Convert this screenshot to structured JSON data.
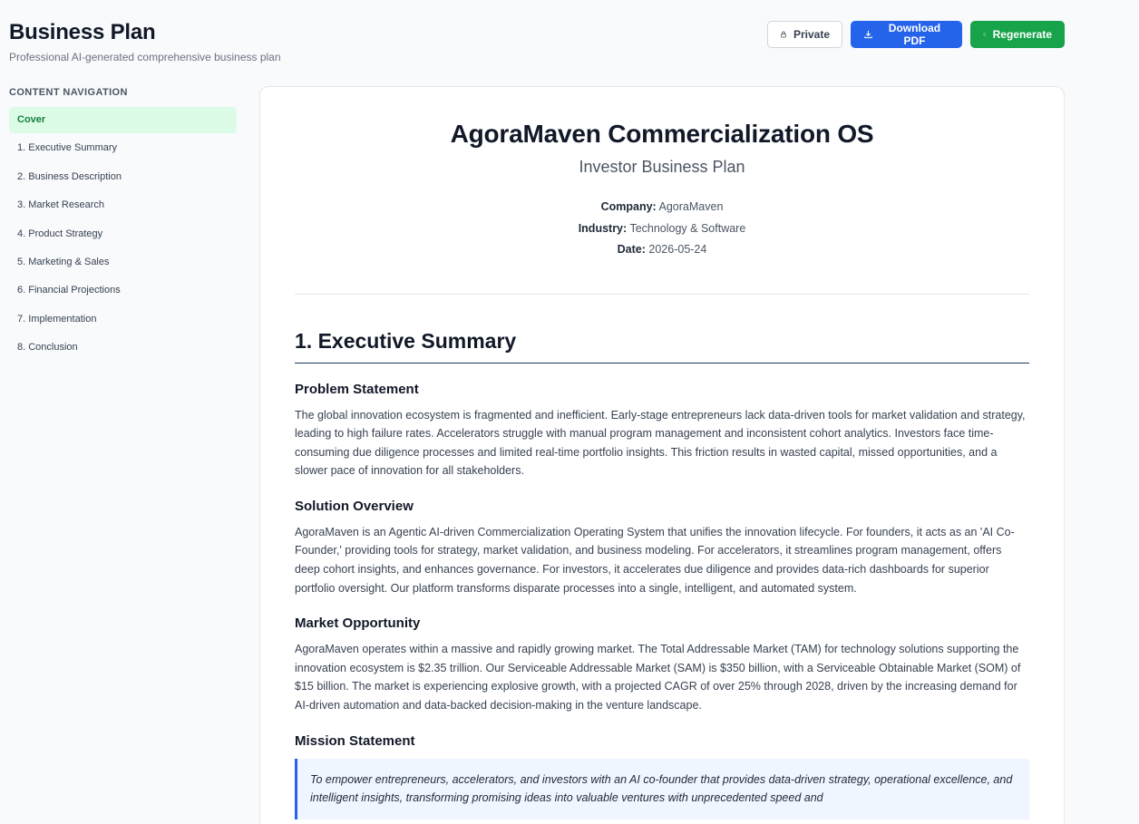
{
  "header": {
    "title": "Business Plan",
    "subtitle": "Professional AI-generated comprehensive business plan"
  },
  "toolbar": {
    "private_label": "Private",
    "download_label": "Download PDF",
    "regenerate_label": "Regenerate"
  },
  "sidebar": {
    "heading": "CONTENT NAVIGATION",
    "items": [
      {
        "label": "Cover",
        "active": true
      },
      {
        "label": "1. Executive Summary"
      },
      {
        "label": "2. Business Description"
      },
      {
        "label": "3. Market Research"
      },
      {
        "label": "4. Product Strategy"
      },
      {
        "label": "5. Marketing & Sales"
      },
      {
        "label": "6. Financial Projections"
      },
      {
        "label": "7. Implementation"
      },
      {
        "label": "8. Conclusion"
      }
    ]
  },
  "document": {
    "title": "AgoraMaven Commercialization OS",
    "subtitle": "Investor Business Plan",
    "meta": {
      "company_label": "Company:",
      "company": "AgoraMaven",
      "industry_label": "Industry:",
      "industry": "Technology & Software",
      "date_label": "Date:",
      "date": "2026-05-24"
    },
    "section_title": "1. Executive Summary",
    "problem": {
      "title": "Problem Statement",
      "text": "The global innovation ecosystem is fragmented and inefficient. Early-stage entrepreneurs lack data-driven tools for market validation and strategy, leading to high failure rates. Accelerators struggle with manual program management and inconsistent cohort analytics. Investors face time-consuming due diligence processes and limited real-time portfolio insights. This friction results in wasted capital, missed opportunities, and a slower pace of innovation for all stakeholders."
    },
    "solution": {
      "title": "Solution Overview",
      "text": "AgoraMaven is an Agentic AI-driven Commercialization Operating System that unifies the innovation lifecycle. For founders, it acts as an 'AI Co-Founder,' providing tools for strategy, market validation, and business modeling. For accelerators, it streamlines program management, offers deep cohort insights, and enhances governance. For investors, it accelerates due diligence and provides data-rich dashboards for superior portfolio oversight. Our platform transforms disparate processes into a single, intelligent, and automated system."
    },
    "market": {
      "title": "Market Opportunity",
      "text": "AgoraMaven operates within a massive and rapidly growing market. The Total Addressable Market (TAM) for technology solutions supporting the innovation ecosystem is $2.35 trillion. Our Serviceable Addressable Market (SAM) is $350 billion, with a Serviceable Obtainable Market (SOM) of $15 billion. The market is experiencing explosive growth, with a projected CAGR of over 25% through 2028, driven by the increasing demand for AI-driven automation and data-backed decision-making in the venture landscape."
    },
    "mission": {
      "title": "Mission Statement",
      "text": "To empower entrepreneurs, accelerators, and investors with an AI co-founder that provides data-driven strategy, operational excellence, and intelligent insights, transforming promising ideas into valuable ventures with unprecedented speed and"
    }
  }
}
